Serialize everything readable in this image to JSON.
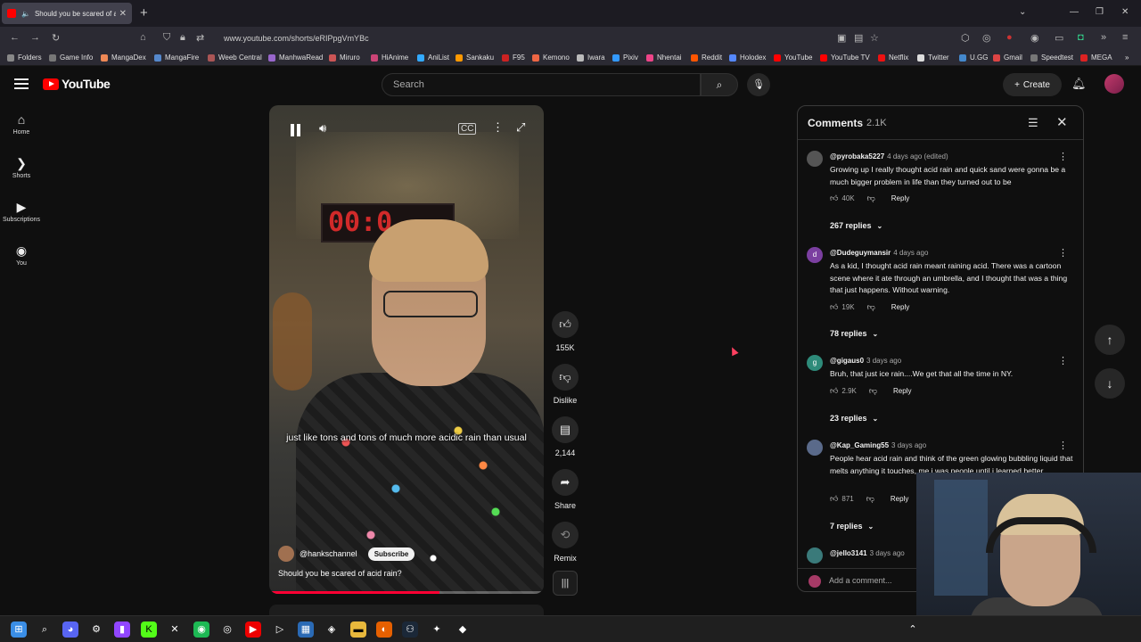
{
  "browser": {
    "tab_title": "Should you be scared of ac",
    "url": "www.youtube.com/shorts/eRIPpgVmYBc",
    "bookmarks": [
      "Folders",
      "Game Info",
      "MangaDex",
      "MangaFire",
      "Weeb Central",
      "ManhwaRead",
      "Miruro",
      "HiAnime",
      "AniList",
      "Sankaku",
      "F95",
      "Kemono",
      "Iwara",
      "Pixiv",
      "Nhentai",
      "Reddit",
      "Holodex",
      "YouTube",
      "YouTube TV",
      "Netflix",
      "Twitter",
      "U.GG",
      "Gmail",
      "Speedtest",
      "MEGA"
    ]
  },
  "header": {
    "logo_text": "YouTube",
    "search_placeholder": "Search",
    "create_label": "Create"
  },
  "sidebar": {
    "items": [
      {
        "label": "Home",
        "icon": "home-icon"
      },
      {
        "label": "Shorts",
        "icon": "shorts-icon"
      },
      {
        "label": "Subscriptions",
        "icon": "subscriptions-icon"
      },
      {
        "label": "You",
        "icon": "you-icon"
      }
    ]
  },
  "video": {
    "caption": "just like tons and tons of much more acidic rain than usual",
    "channel": "@hankschannel",
    "subscribe_label": "Subscribe",
    "title": "Should you be scared of acid rain?",
    "clock_text": "00:0",
    "progress": 0.62
  },
  "actions": {
    "like_count": "155K",
    "dislike_label": "Dislike",
    "comment_count": "2,144",
    "share_label": "Share",
    "remix_label": "Remix"
  },
  "comments": {
    "title": "Comments",
    "count": "2.1K",
    "add_placeholder": "Add a comment...",
    "items": [
      {
        "user": "@pyrobaka5227",
        "time": "4 days ago (edited)",
        "text": "Growing up I really thought acid rain and quick sand were gonna be a much bigger problem in life than they turned out to be",
        "likes": "40K",
        "reply_label": "Reply",
        "replies": "267 replies",
        "avatar_letter": "",
        "avatar_color": "#555555"
      },
      {
        "user": "@Dudeguymansir",
        "time": "4 days ago",
        "text": "As a kid, I thought acid rain meant raining acid. There was a cartoon scene where it ate through an umbrella, and I thought that was a thing that just happens. Without warning.",
        "likes": "19K",
        "reply_label": "Reply",
        "replies": "78 replies",
        "avatar_letter": "d",
        "avatar_color": "#7b3fa0"
      },
      {
        "user": "@gigaus0",
        "time": "3 days ago",
        "text": "Bruh, that just ice rain....We get that all the time in NY.",
        "likes": "2.9K",
        "reply_label": "Reply",
        "replies": "23 replies",
        "avatar_letter": "g",
        "avatar_color": "#2e8b7a"
      },
      {
        "user": "@Kap_Gaming55",
        "time": "3 days ago",
        "text": "People hear acid rain and think of the green glowing bubbling liquid that melts anything it touches, me i was people until i learned better.",
        "likes": "871",
        "reply_label": "Reply",
        "replies": "7 replies",
        "avatar_letter": "",
        "avatar_color": "#5a6a8a"
      },
      {
        "user": "@jello3141",
        "time": "3 days ago",
        "text": "",
        "likes": "",
        "reply_label": "",
        "replies": "",
        "avatar_letter": "",
        "avatar_color": "#3a7a7a"
      }
    ]
  },
  "colors": {
    "accent": "#ff0000",
    "background": "#0f0f0f",
    "progress": "#ff0033"
  }
}
